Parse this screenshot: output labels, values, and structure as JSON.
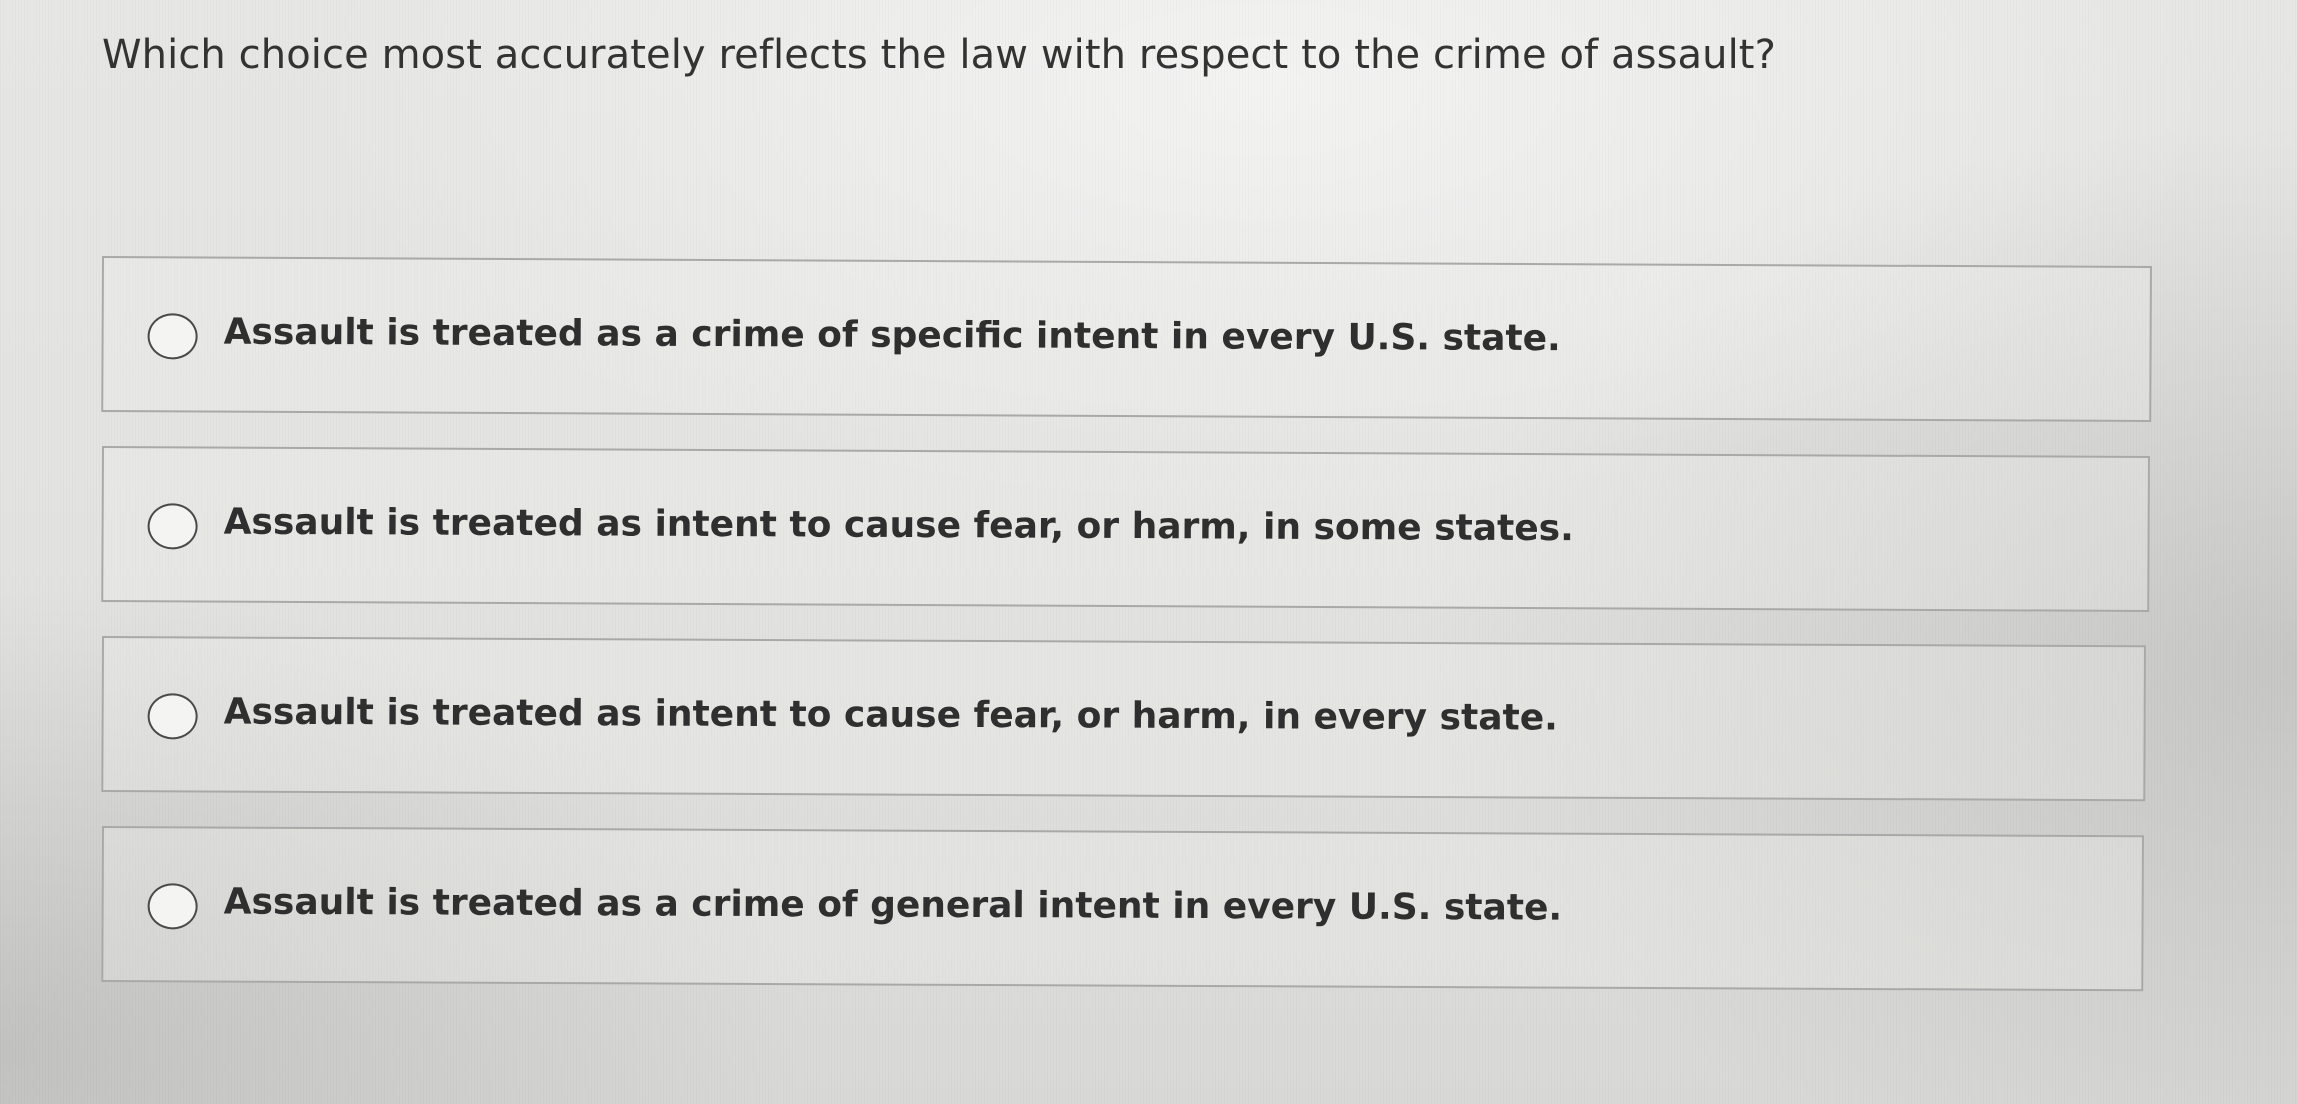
{
  "question": {
    "text": "Which choice most accurately reflects the law with respect to the crime of assault?"
  },
  "options": [
    {
      "label": "Assault is treated as a crime of specific intent in every U.S. state.",
      "selected": false
    },
    {
      "label": "Assault is treated as intent to cause fear, or harm, in some states.",
      "selected": false
    },
    {
      "label": "Assault is treated as intent to cause fear, or harm, in every state.",
      "selected": false
    },
    {
      "label": "Assault is treated as a crime of general intent in every U.S. state.",
      "selected": false
    }
  ]
}
